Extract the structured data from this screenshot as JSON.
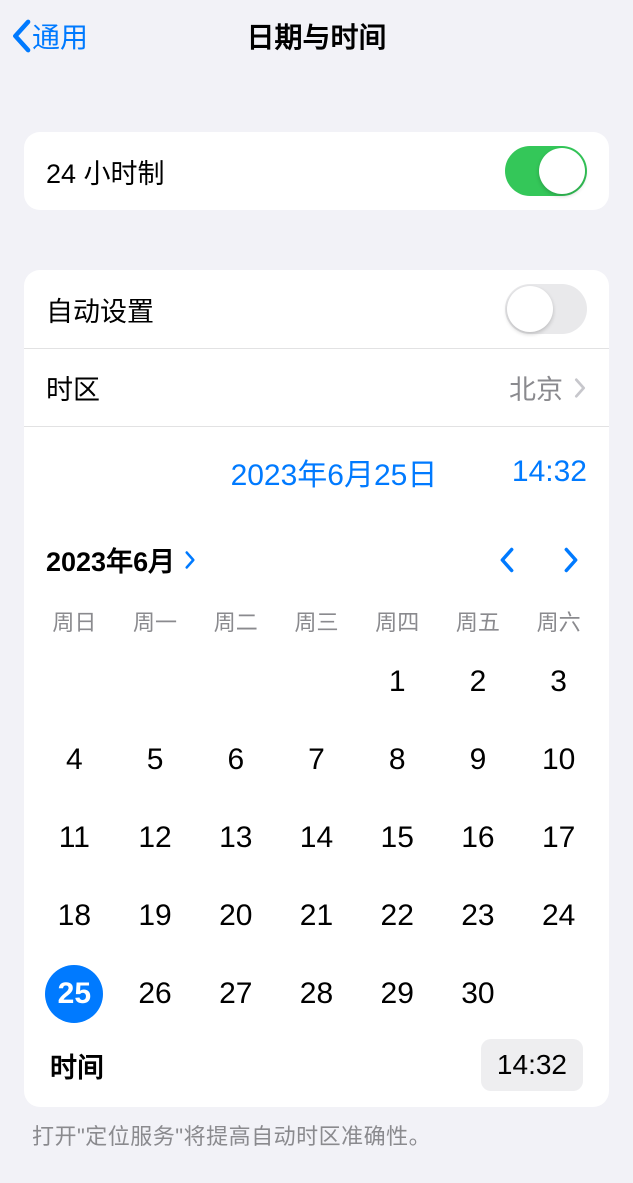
{
  "nav": {
    "back_label": "通用",
    "title": "日期与时间"
  },
  "hour24": {
    "label": "24 小时制",
    "on": true
  },
  "auto_set": {
    "label": "自动设置",
    "on": false
  },
  "timezone": {
    "label": "时区",
    "value": "北京"
  },
  "selected_date_label": "2023年6月25日",
  "selected_time": "14:32",
  "calendar": {
    "month_label": "2023年6月",
    "weekdays": [
      "周日",
      "周一",
      "周二",
      "周三",
      "周四",
      "周五",
      "周六"
    ],
    "first_weekday": 4,
    "num_days": 30,
    "selected_day": 25
  },
  "time_row": {
    "label": "时间",
    "value": "14:32"
  },
  "footer": "打开\"定位服务\"将提高自动时区准确性。"
}
